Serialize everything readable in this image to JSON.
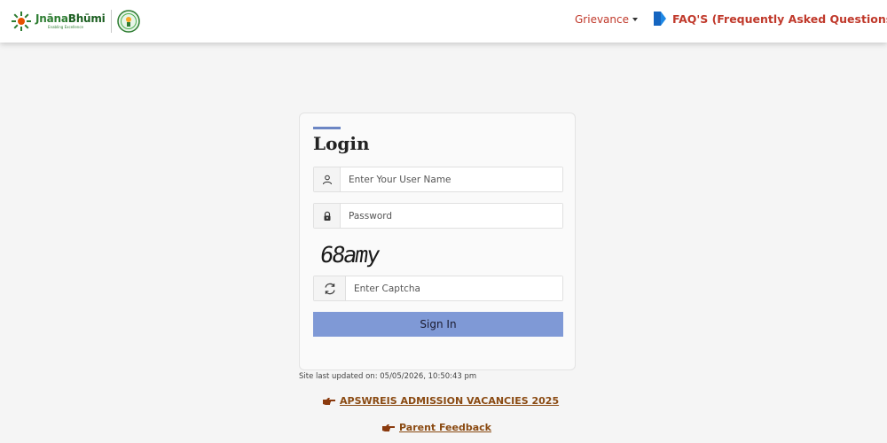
{
  "header": {
    "logo": {
      "name_part1": "Jnāna",
      "name_part2": "Bhūmi",
      "tagline": "Enabling Excellence"
    },
    "nav": {
      "grievance_label": "Grievance",
      "faq_label": "FAQ'S (Frequently Asked Questions)"
    }
  },
  "login": {
    "title": "Login",
    "username_placeholder": "Enter Your User Name",
    "password_placeholder": "Password",
    "captcha_text": "68amy",
    "captcha_placeholder": "Enter Captcha",
    "signin_label": "Sign In"
  },
  "footer": {
    "site_updated": "Site last updated on: 05/05/2026, 10:50:43 pm",
    "links": [
      {
        "label": " APSWREIS ADMISSION VACANCIES 2025"
      },
      {
        "label": " Parent Feedback"
      }
    ]
  },
  "colors": {
    "brand_green": "#2e7d32",
    "nav_red": "#c0392b",
    "signin_blue": "#7f99d6",
    "link_brown": "#8a4a12",
    "faq_icon_blue": "#1e88e5"
  },
  "icons": {
    "user": "user-icon",
    "password": "lock-icon",
    "captcha_refresh": "refresh-icon",
    "faq": "faq-tag-icon",
    "links": "pointing-hand-icon"
  }
}
